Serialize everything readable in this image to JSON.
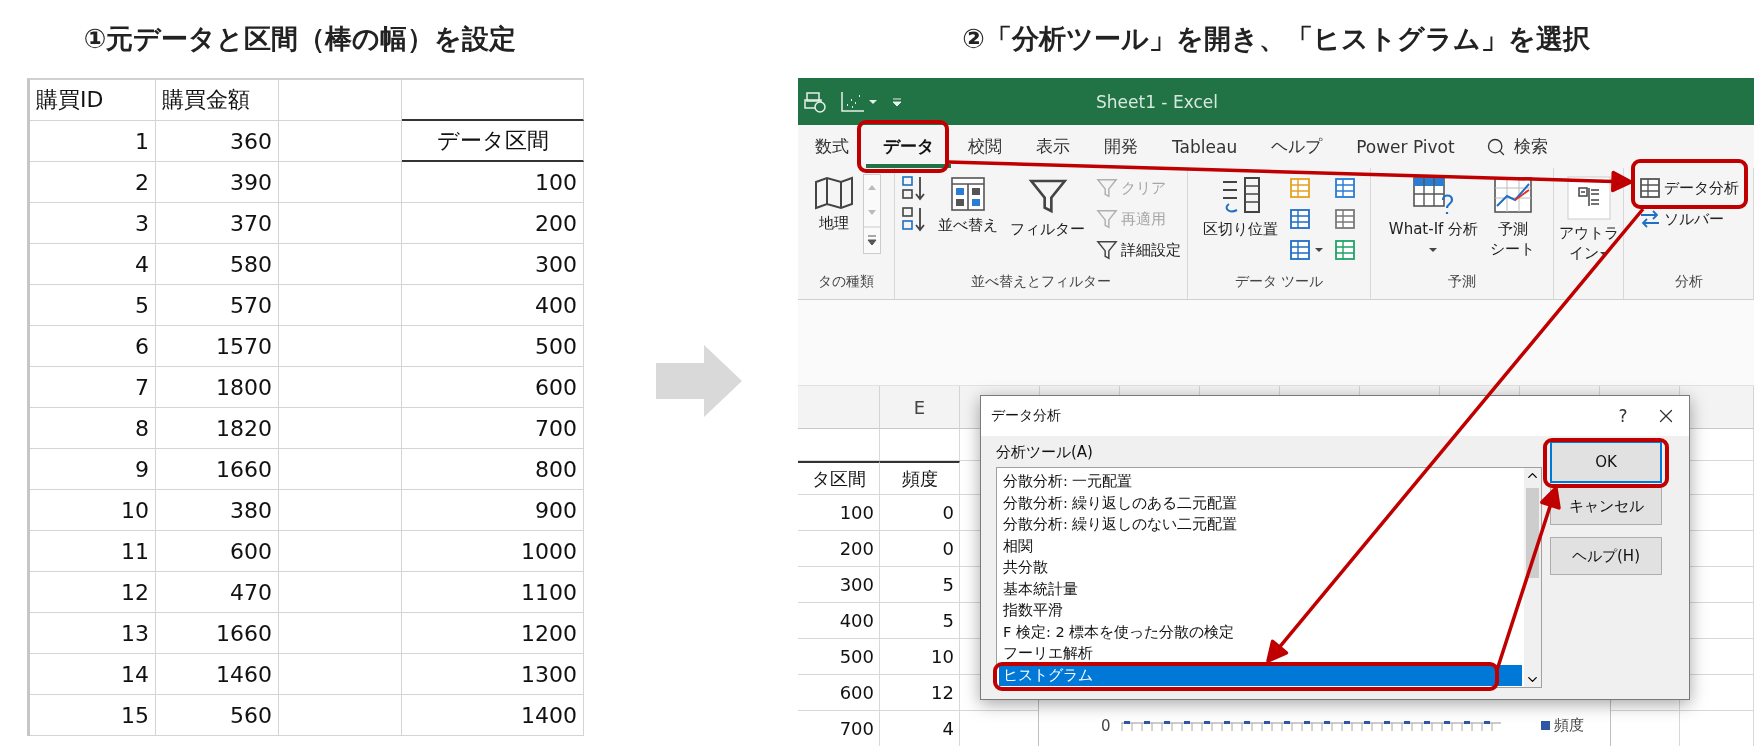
{
  "left": {
    "title": "①元データと区間（棒の幅）を設定",
    "headers": [
      "購買ID",
      "購買金額"
    ],
    "bin_header": "データ区間",
    "rows": [
      {
        "id": "1",
        "amount": "360"
      },
      {
        "id": "2",
        "amount": "390",
        "bin": "100"
      },
      {
        "id": "3",
        "amount": "370",
        "bin": "200"
      },
      {
        "id": "4",
        "amount": "580",
        "bin": "300"
      },
      {
        "id": "5",
        "amount": "570",
        "bin": "400"
      },
      {
        "id": "6",
        "amount": "1570",
        "bin": "500"
      },
      {
        "id": "7",
        "amount": "1800",
        "bin": "600"
      },
      {
        "id": "8",
        "amount": "1820",
        "bin": "700"
      },
      {
        "id": "9",
        "amount": "1660",
        "bin": "800"
      },
      {
        "id": "10",
        "amount": "380",
        "bin": "900"
      },
      {
        "id": "11",
        "amount": "600",
        "bin": "1000"
      },
      {
        "id": "12",
        "amount": "470",
        "bin": "1100"
      },
      {
        "id": "13",
        "amount": "1660",
        "bin": "1200"
      },
      {
        "id": "14",
        "amount": "1460",
        "bin": "1300"
      },
      {
        "id": "15",
        "amount": "560",
        "bin": "1400"
      }
    ]
  },
  "right": {
    "title": "②「分析ツール」を開き、「ヒストグラム」を選択",
    "excel": {
      "window_title": "Sheet1 - Excel",
      "tabs": [
        {
          "label": "数式",
          "selected": false
        },
        {
          "label": "データ",
          "selected": true
        },
        {
          "label": "校閲",
          "selected": false
        },
        {
          "label": "表示",
          "selected": false
        },
        {
          "label": "開発",
          "selected": false
        },
        {
          "label": "Tableau",
          "selected": false
        },
        {
          "label": "ヘルプ",
          "selected": false
        },
        {
          "label": "Power Pivot",
          "selected": false
        }
      ],
      "search_label": "検索",
      "ribbon_groups": [
        {
          "label": "タの種類",
          "buttons": [
            {
              "kind": "large",
              "label": "地理"
            }
          ]
        },
        {
          "label": "並べ替えとフィルター",
          "buttons": [
            {
              "kind": "icon"
            },
            {
              "kind": "icon"
            },
            {
              "kind": "large",
              "label": "並べ替え"
            },
            {
              "kind": "large",
              "label": "フィルター"
            },
            {
              "kind": "small",
              "label": "クリア",
              "disabled": true
            },
            {
              "kind": "small",
              "label": "再適用",
              "disabled": true
            },
            {
              "kind": "small",
              "label": "詳細設定",
              "disabled": false
            }
          ]
        },
        {
          "label": "データ ツール",
          "buttons": [
            {
              "kind": "large",
              "label": "区切り位置"
            },
            {
              "kind": "icon"
            },
            {
              "kind": "icon"
            },
            {
              "kind": "icon",
              "dropdown": true
            },
            {
              "kind": "icon"
            },
            {
              "kind": "icon"
            },
            {
              "kind": "icon"
            }
          ]
        },
        {
          "label": "予測",
          "buttons": [
            {
              "kind": "large",
              "label": "What-If 分析",
              "dropdown": true
            },
            {
              "kind": "large",
              "label_lines": [
                "予測",
                "シート"
              ]
            }
          ]
        },
        {
          "buttons": [
            {
              "kind": "large",
              "label_lines": [
                "アウトラ",
                "イン"
              ],
              "dropdown": true
            }
          ]
        },
        {
          "label": "分析",
          "buttons": [
            {
              "kind": "small",
              "label": "データ分析",
              "disabled": false
            },
            {
              "kind": "small",
              "label": "ソルバー",
              "disabled": false
            }
          ]
        }
      ],
      "sheet": {
        "column_headers": [
          "E"
        ],
        "header_row": [
          "タ区間",
          "頻度"
        ],
        "rows": [
          [
            "100",
            "0"
          ],
          [
            "200",
            "0"
          ],
          [
            "300",
            "5"
          ],
          [
            "400",
            "5"
          ],
          [
            "500",
            "10"
          ],
          [
            "600",
            "12"
          ],
          [
            "700",
            "4"
          ]
        ]
      },
      "chart": {
        "axis_label": "0",
        "legend": "頻度"
      },
      "dialog": {
        "title": "データ分析",
        "help": "?",
        "list_label": "分析ツール(A)",
        "items": [
          {
            "label": "分散分析: 一元配置",
            "selected": false
          },
          {
            "label": "分散分析: 繰り返しのある二元配置",
            "selected": false
          },
          {
            "label": "分散分析: 繰り返しのない二元配置",
            "selected": false
          },
          {
            "label": "相関",
            "selected": false
          },
          {
            "label": "共分散",
            "selected": false
          },
          {
            "label": "基本統計量",
            "selected": false
          },
          {
            "label": "指数平滑",
            "selected": false
          },
          {
            "label": "F 検定: 2 標本を使った分散の検定",
            "selected": false
          },
          {
            "label": "フーリエ解析",
            "selected": false
          },
          {
            "label": "ヒストグラム",
            "selected": true
          }
        ],
        "buttons": [
          {
            "label": "OK",
            "default": true
          },
          {
            "label": "キャンセル",
            "default": false
          },
          {
            "label": "ヘルプ(H)",
            "default": false
          }
        ]
      }
    }
  }
}
